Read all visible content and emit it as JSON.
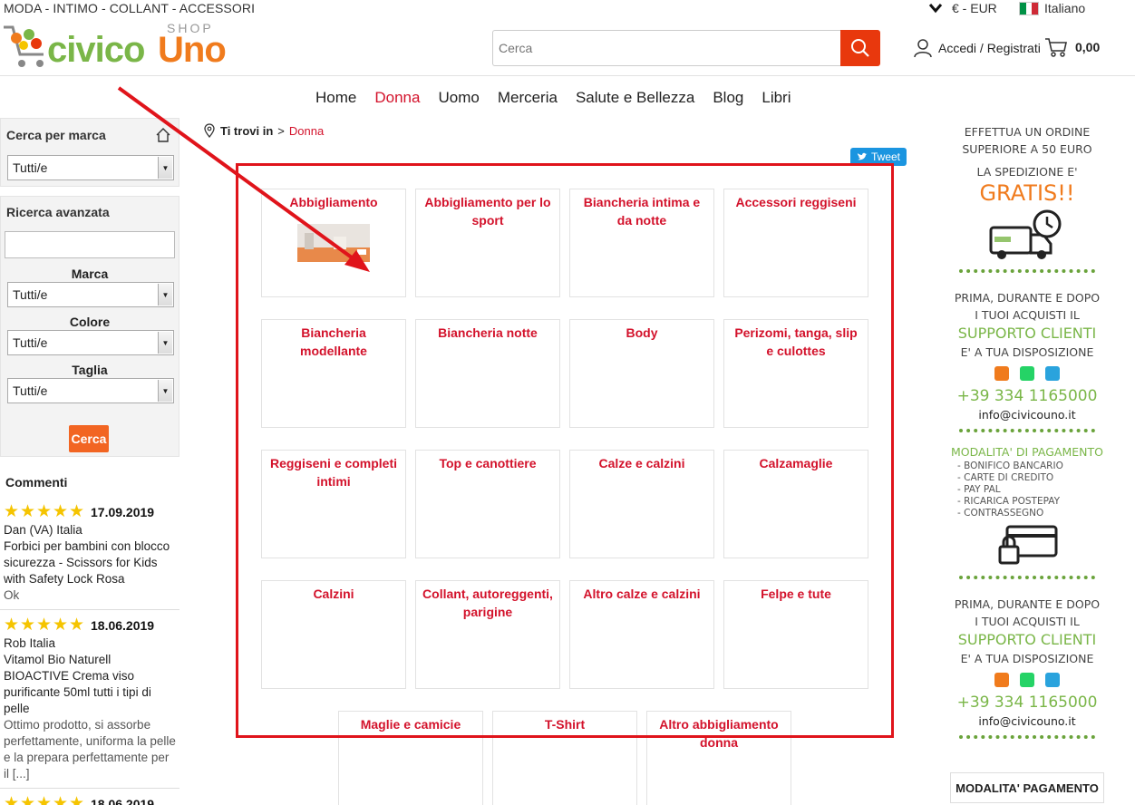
{
  "topbar": {
    "categories": "MODA - INTIMO - COLLANT - ACCESSORI",
    "currency": "€ - EUR",
    "language": "Italiano"
  },
  "header": {
    "logo_text": "civicoUno",
    "logo_shop": "SHOP",
    "search_placeholder": "Cerca",
    "account_label": "Accedi / Registrati",
    "cart_total": "0,00"
  },
  "nav": {
    "items": [
      {
        "label": "Home",
        "active": false
      },
      {
        "label": "Donna",
        "active": true
      },
      {
        "label": "Uomo",
        "active": false
      },
      {
        "label": "Merceria",
        "active": false
      },
      {
        "label": "Salute e Bellezza",
        "active": false
      },
      {
        "label": "Blog",
        "active": false
      },
      {
        "label": "Libri",
        "active": false
      }
    ]
  },
  "sidebar": {
    "brand_search_title": "Cerca per marca",
    "brand_select_value": "Tutti/e",
    "advanced_title": "Ricerca avanzata",
    "text_input_value": "",
    "marca_label": "Marca",
    "marca_value": "Tutti/e",
    "colore_label": "Colore",
    "colore_value": "Tutti/e",
    "taglia_label": "Taglia",
    "taglia_value": "Tutti/e",
    "search_button": "Cerca"
  },
  "comments": {
    "title": "Commenti",
    "items": [
      {
        "date": "17.09.2019",
        "author": "Dan (VA) Italia",
        "product": "Forbici per bambini con blocco sicurezza - Scissors for Kids with Safety Lock Rosa",
        "text": "Ok"
      },
      {
        "date": "18.06.2019",
        "author": "Rob Italia",
        "product": "Vitamol Bio Naturell BIOACTIVE Crema viso purificante 50ml tutti i tipi di pelle",
        "text": "Ottimo prodotto, si assorbe perfettamente, uniforma la pelle e la prepara perfettamente per il [...]"
      },
      {
        "date": "18.06.2019",
        "author": "",
        "product": "",
        "text": ""
      }
    ]
  },
  "breadcrumb": {
    "prefix": "Ti trovi in",
    "separator": ">",
    "current": "Donna"
  },
  "tweet_label": "Tweet",
  "categories": [
    "Abbigliamento",
    "Abbigliamento per lo sport",
    "Biancheria intima e da notte",
    "Accessori reggiseni",
    "Biancheria modellante",
    "Biancheria notte",
    "Body",
    "Perizomi, tanga, slip e culottes",
    "Reggiseni e completi intimi",
    "Top e canottiere",
    "Calze e calzini",
    "Calzamaglie",
    "Calzini",
    "Collant, autoreggenti, parigine",
    "Altro calze e calzini",
    "Felpe e tute",
    "Maglie e camicie",
    "T-Shirt",
    "Altro abbigliamento donna"
  ],
  "right_column": {
    "order_line1": "EFFETTUA UN ORDINE",
    "order_line2": "SUPERIORE A 50 EURO",
    "shipping_line": "LA SPEDIZIONE E'",
    "free_label": "GRATIS!!",
    "support_line1": "PRIMA, DURANTE E DOPO",
    "support_line2": "I TUOI ACQUISTI IL",
    "support_title": "SUPPORTO CLIENTI",
    "support_line3": "E' A TUA DISPOSIZIONE",
    "phone": "+39 334 1165000",
    "email": "info@civicouno.it",
    "payment_title": "MODALITA' DI PAGAMENTO",
    "payment_methods": [
      "- BONIFICO BANCARIO",
      "- CARTE DI CREDITO",
      "- PAY PAL",
      "- RICARICA POSTEPAY",
      "- CONTRASSEGNO"
    ],
    "modalita_box": "MODALITA' PAGAMENTO"
  },
  "colors": {
    "accent_red": "#d3122b",
    "search_button": "#e8380d",
    "orange": "#f26522",
    "green": "#7ab648",
    "frame_red": "#e0141b"
  }
}
